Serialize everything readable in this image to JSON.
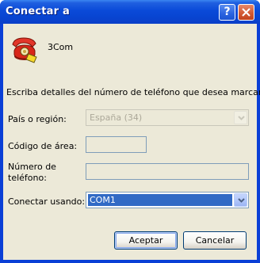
{
  "window": {
    "title": "Conectar a",
    "help_button": "?",
    "close_button": "✕"
  },
  "connection": {
    "name": "3Com",
    "icon": "phone-icon"
  },
  "instructions": "Escriba detalles del número de teléfono que desea marcar:",
  "fields": {
    "country": {
      "label": "País o región:",
      "value": "España (34)"
    },
    "area_code": {
      "label": "Código de área:",
      "value": ""
    },
    "phone_number": {
      "label_line1": "Número de",
      "label_line2": "teléfono:",
      "value": ""
    },
    "connect_using": {
      "label": "Conectar usando:",
      "value": "COM1"
    }
  },
  "buttons": {
    "accept": "Aceptar",
    "cancel": "Cancelar"
  },
  "colors": {
    "title_bar": "#0a4ad8",
    "dialog_bg": "#ece9d8",
    "selection": "#316ac5",
    "input_border": "#7f9db9"
  }
}
